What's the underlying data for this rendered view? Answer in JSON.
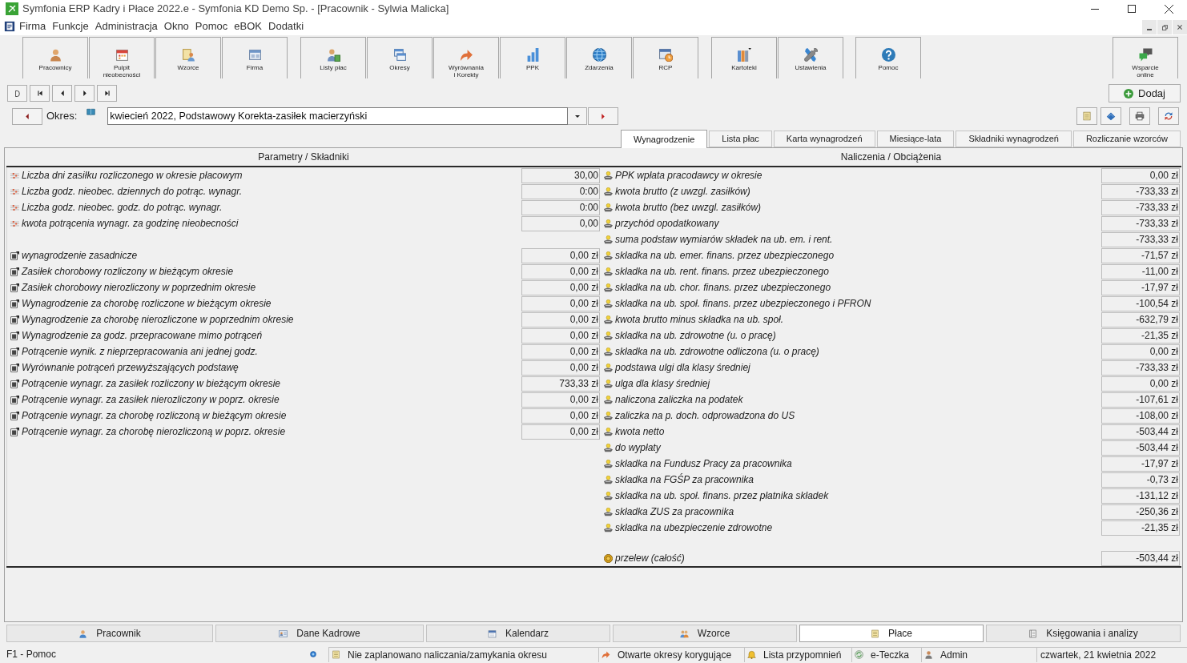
{
  "window": {
    "title": "Symfonia ERP Kadry i Płace 2022.e - Symfonia KD Demo Sp. - [Pracownik - Sylwia Malicka]"
  },
  "menu": [
    "Firma",
    "Funkcje",
    "Administracja",
    "Okno",
    "Pomoc",
    "eBOK",
    "Dodatki"
  ],
  "toolbar": {
    "groups": [
      [
        "Pracownicy",
        "Pulpit nieobecności",
        "Wzorce",
        "Firma"
      ],
      [
        "Listy płac",
        "Okresy",
        "Wyrównania i Korekty",
        "PPK",
        "Zdarzenia",
        "RCP"
      ],
      [
        "Kartoteki",
        "Ustawienia"
      ],
      [
        "Pomoc"
      ]
    ],
    "right": [
      "Wsparcie online"
    ]
  },
  "add_button": "Dodaj",
  "period": {
    "label": "Okres:",
    "value": "kwiecień 2022, Podstawowy Korekta-zasiłek macierzyński"
  },
  "tabs": [
    {
      "label": "Wynagrodzenie",
      "selected": true
    },
    {
      "label": "Lista płac",
      "selected": false
    },
    {
      "label": "Karta wynagrodzeń",
      "selected": false
    },
    {
      "label": "Miesiące-lata",
      "selected": false
    },
    {
      "label": "Składniki wynagrodzeń",
      "selected": false
    },
    {
      "label": "Rozliczanie wzorców",
      "selected": false
    }
  ],
  "parameters_panel": {
    "header": "Parametry / Składniki",
    "parameters": [
      {
        "label": "Liczba dni zasiłku rozliczonego w okresie płacowym",
        "value": "30,00"
      },
      {
        "label": "Liczba godz. nieobec. dziennych do potrąc. wynagr.",
        "value": "0:00"
      },
      {
        "label": "Liczba godz. nieobec. godz. do potrąc. wynagr.",
        "value": "0:00"
      },
      {
        "label": "kwota potrącenia wynagr. za godzinę nieobecności",
        "value": "0,00"
      }
    ],
    "components": [
      {
        "label": "wynagrodzenie zasadnicze",
        "value": "0,00 zł"
      },
      {
        "label": "Zasiłek chorobowy rozliczony w bieżącym okresie",
        "value": "0,00 zł"
      },
      {
        "label": "Zasiłek chorobowy nierozliczony w poprzednim okresie",
        "value": "0,00 zł"
      },
      {
        "label": "Wynagrodzenie za chorobę rozliczone w bieżącym okresie",
        "value": "0,00 zł"
      },
      {
        "label": "Wynagrodzenie za chorobę nierozliczone w poprzednim okresie",
        "value": "0,00 zł"
      },
      {
        "label": "Wynagrodzenie za godz. przepracowane mimo potrąceń",
        "value": "0,00 zł"
      },
      {
        "label": "Potrącenie wynik. z nieprzepracowania ani jednej godz.",
        "value": "0,00 zł"
      },
      {
        "label": "Wyrównanie potrąceń przewyższających podstawę",
        "value": "0,00 zł"
      },
      {
        "label": "Potrącenie wynagr. za zasiłek rozliczony w bieżącym okresie",
        "value": "733,33 zł"
      },
      {
        "label": "Potrącenie wynagr. za zasiłek nierozliczony w poprz. okresie",
        "value": "0,00 zł"
      },
      {
        "label": "Potrącenie wynagr. za chorobę rozliczoną w bieżącym okresie",
        "value": "0,00 zł"
      },
      {
        "label": "Potrącenie wynagr. za chorobę nierozliczoną w poprz. okresie",
        "value": "0,00 zł"
      }
    ]
  },
  "charges_panel": {
    "header": "Naliczenia / Obciążenia",
    "items": [
      {
        "label": "PPK wpłata pracodawcy w okresie",
        "value": "0,00 zł"
      },
      {
        "label": "kwota brutto (z uwzgl. zasiłków)",
        "value": "-733,33 zł"
      },
      {
        "label": "kwota brutto (bez uwzgl. zasiłków)",
        "value": "-733,33 zł"
      },
      {
        "label": "przychód opodatkowany",
        "value": "-733,33 zł"
      },
      {
        "label": "suma podstaw wymiarów składek na ub. em. i rent.",
        "value": "-733,33 zł"
      },
      {
        "label": "składka na ub. emer. finans. przez ubezpieczonego",
        "value": "-71,57 zł"
      },
      {
        "label": "składka na ub. rent. finans. przez ubezpieczonego",
        "value": "-11,00 zł"
      },
      {
        "label": "składka na ub. chor. finans. przez ubezpieczonego",
        "value": "-17,97 zł"
      },
      {
        "label": "składka na ub. społ. finans. przez ubezpieczonego i PFRON",
        "value": "-100,54 zł"
      },
      {
        "label": "kwota brutto minus składka na ub. społ.",
        "value": "-632,79 zł"
      },
      {
        "label": "składka na ub. zdrowotne (u. o pracę)",
        "value": "-21,35 zł"
      },
      {
        "label": "składka na ub. zdrowotne odliczona (u. o pracę)",
        "value": "0,00 zł"
      },
      {
        "label": "podstawa ulgi dla klasy średniej",
        "value": "-733,33 zł"
      },
      {
        "label": "ulga dla klasy średniej",
        "value": "0,00 zł"
      },
      {
        "label": "naliczona zaliczka na podatek",
        "value": "-107,61 zł"
      },
      {
        "label": "zaliczka na p. doch. odprowadzona do US",
        "value": "-108,00 zł"
      },
      {
        "label": "kwota netto",
        "value": "-503,44 zł"
      },
      {
        "label": "do wypłaty",
        "value": "-503,44 zł"
      },
      {
        "label": "składka na Fundusz Pracy za pracownika",
        "value": "-17,97 zł"
      },
      {
        "label": "składka na FGŚP za pracownika",
        "value": "-0,73 zł"
      },
      {
        "label": "składka na ub. społ. finans. przez płatnika składek",
        "value": "-131,12 zł"
      },
      {
        "label": "składka ZUS za pracownika",
        "value": "-250,36 zł"
      },
      {
        "label": "składka na ubezpieczenie zdrowotne",
        "value": "-21,35 zł"
      }
    ],
    "total": {
      "label": "przelew (całość)",
      "value": "-503,44 zł"
    }
  },
  "bottom_tabs": [
    {
      "label": "Pracownik",
      "selected": false
    },
    {
      "label": "Dane Kadrowe",
      "selected": false
    },
    {
      "label": "Kalendarz",
      "selected": false
    },
    {
      "label": "Wzorce",
      "selected": false
    },
    {
      "label": "Płace",
      "selected": true
    },
    {
      "label": "Księgowania i analizy",
      "selected": false
    }
  ],
  "status_bar": {
    "help": "F1 - Pomoc",
    "items": [
      "Nie zaplanowano naliczania/zamykania okresu",
      "Otwarte okresy korygujące",
      "Lista przypomnień",
      "e-Teczka",
      "Admin"
    ],
    "date": "czwartek, 21 kwietnia 2022"
  }
}
